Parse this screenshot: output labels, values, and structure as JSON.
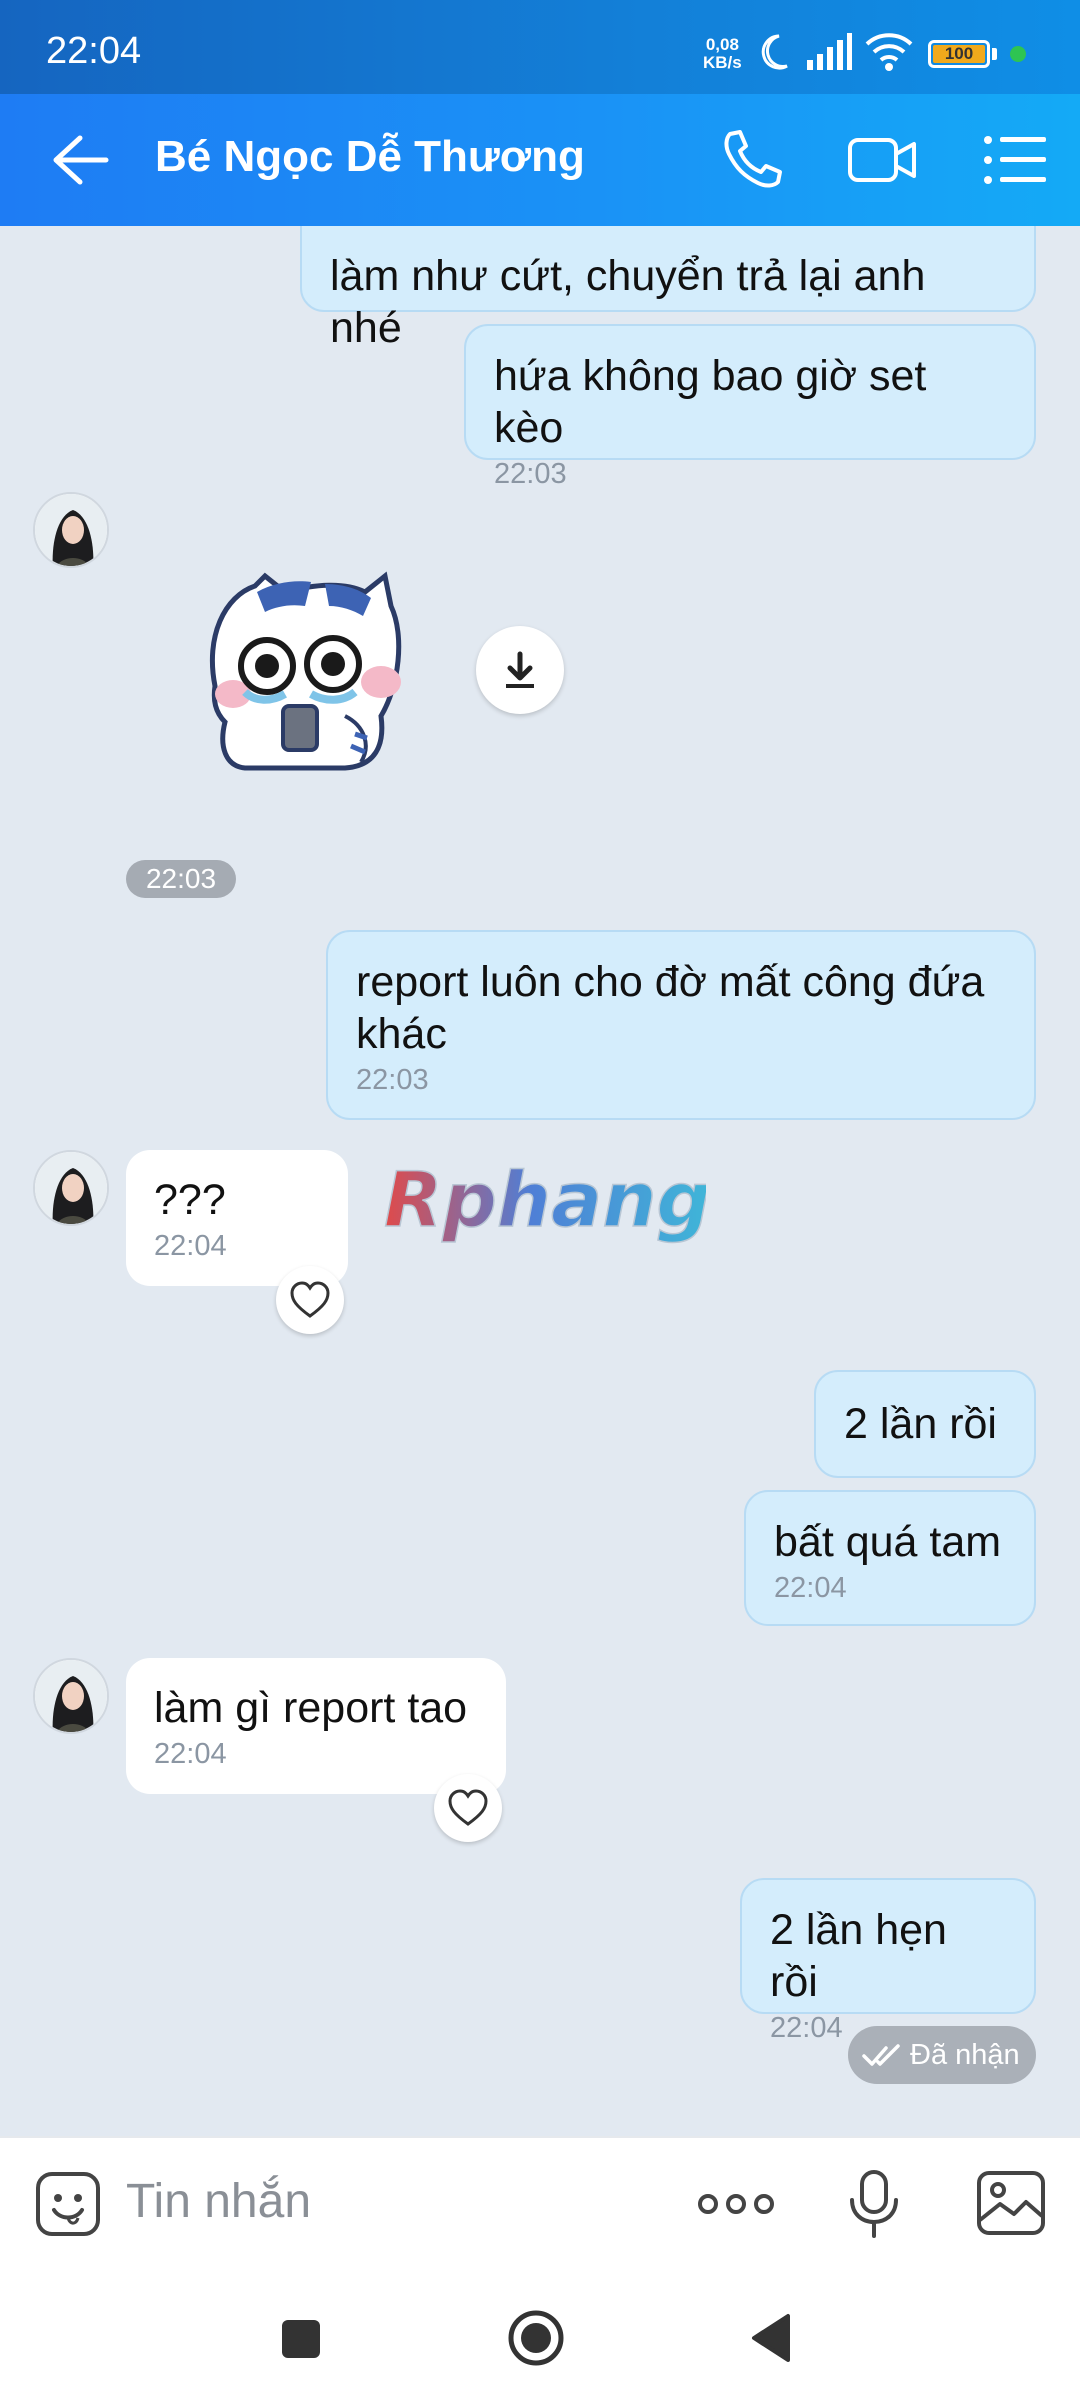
{
  "status_bar": {
    "time": "22:04",
    "net_speed_value": "0,08",
    "net_speed_unit": "KB/s",
    "battery": "100"
  },
  "header": {
    "contact_name": "Bé Ngọc Dễ Thương"
  },
  "messages": [
    {
      "text": "làm như cứt, chuyển trả lại anh nhé"
    },
    {
      "text": "hứa không bao giờ set kèo",
      "time": "22:03"
    },
    {
      "sticker_time": "22:03"
    },
    {
      "text": "report luôn cho đờ mất công đứa khác",
      "time": "22:03"
    },
    {
      "text": "???",
      "time": "22:04"
    },
    {
      "text": "2 lần rồi"
    },
    {
      "text": "bất quá tam",
      "time": "22:04"
    },
    {
      "text": "làm gì report tao",
      "time": "22:04"
    },
    {
      "text": "2 lần hẹn rồi",
      "time": "22:04"
    }
  ],
  "receipt": {
    "label": "Đã nhận"
  },
  "watermark": {
    "text": "Rphang"
  },
  "input": {
    "placeholder": "Tin nhắn"
  },
  "icons": {
    "back": "arrow-left-icon",
    "call": "phone-icon",
    "video": "video-camera-icon",
    "menu": "list-menu-icon",
    "emoji": "emoji-icon",
    "more": "more-dots-icon",
    "mic": "microphone-icon",
    "image": "image-icon"
  },
  "colors": {
    "header_start": "#1e7cf4",
    "header_end": "#14aaf6",
    "my_bubble": "#d4edfc",
    "their_bubble": "#ffffff",
    "chat_bg": "#e2e9f1"
  }
}
